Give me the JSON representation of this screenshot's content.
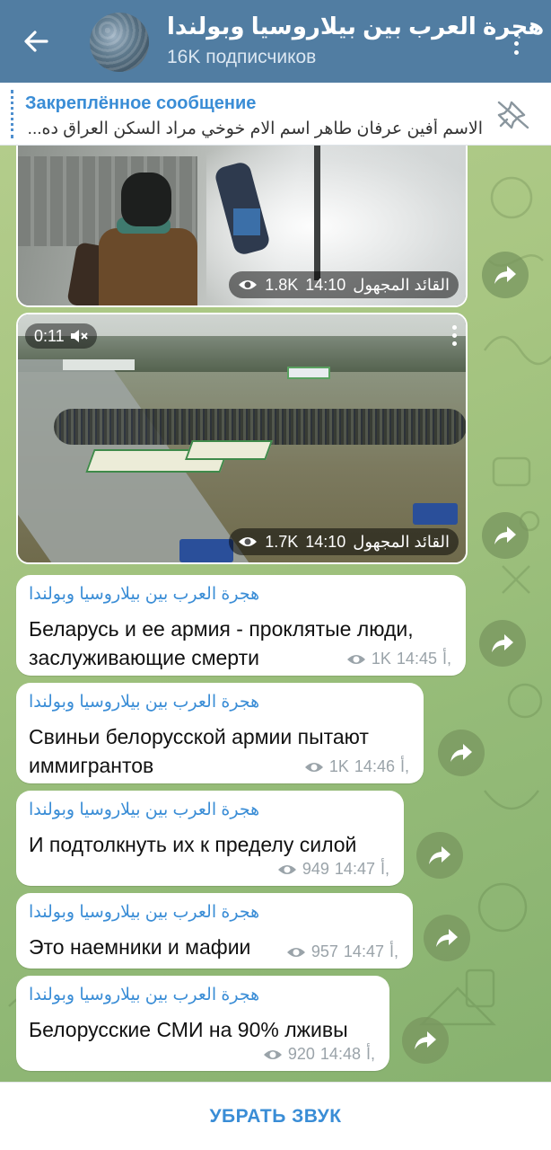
{
  "header": {
    "title": "هجرة العرب بين بيلاروسيا وبولندا",
    "subtitle": "16K подписчиков"
  },
  "pinned": {
    "label": "Закреплённое сообщение",
    "text": "الاسم أفين عرفان طاهر اسم الام خوخي مراد السكن العراق ده..."
  },
  "media": [
    {
      "author": "القائد المجهول",
      "time": "14:10",
      "views": "1.8K"
    },
    {
      "author": "القائد المجهول",
      "time": "14:10",
      "views": "1.7K",
      "duration": "0:11"
    }
  ],
  "messages": [
    {
      "sender": "هجرة العرب بين بيلاروسيا وبولندا",
      "text": "Беларусь и ее армия - проклятые люди, заслуживающие смерти",
      "views": "1K",
      "time": "14:45",
      "sign": "أ,"
    },
    {
      "sender": "هجرة العرب بين بيلاروسيا وبولندا",
      "text": "Свиньи белорусской армии пытают иммигрантов",
      "views": "1K",
      "time": "14:46",
      "sign": "أ,"
    },
    {
      "sender": "هجرة العرب بين بيلاروسيا وبولندا",
      "text": "И подтолкнуть их к пределу силой",
      "views": "949",
      "time": "14:47",
      "sign": "أ,"
    },
    {
      "sender": "هجرة العرب بين بيلاروسيا وبولندا",
      "text": "Это наемники и мафии",
      "views": "957",
      "time": "14:47",
      "sign": "أ,"
    },
    {
      "sender": "هجرة العرب بين بيلاروسيا وبولندا",
      "text": "Белорусские СМИ на 90% лживы",
      "views": "920",
      "time": "14:48",
      "sign": "أ,"
    }
  ],
  "bottom": {
    "unmute_label": "УБРАТЬ ЗВУК"
  },
  "colors": {
    "header": "#517da2",
    "accent": "#3a8dd6",
    "chat_bg": "#a8c682"
  },
  "icons": [
    "back-arrow-icon",
    "more-vert-icon",
    "pin-off-icon",
    "eye-icon",
    "mute-icon",
    "share-icon"
  ]
}
